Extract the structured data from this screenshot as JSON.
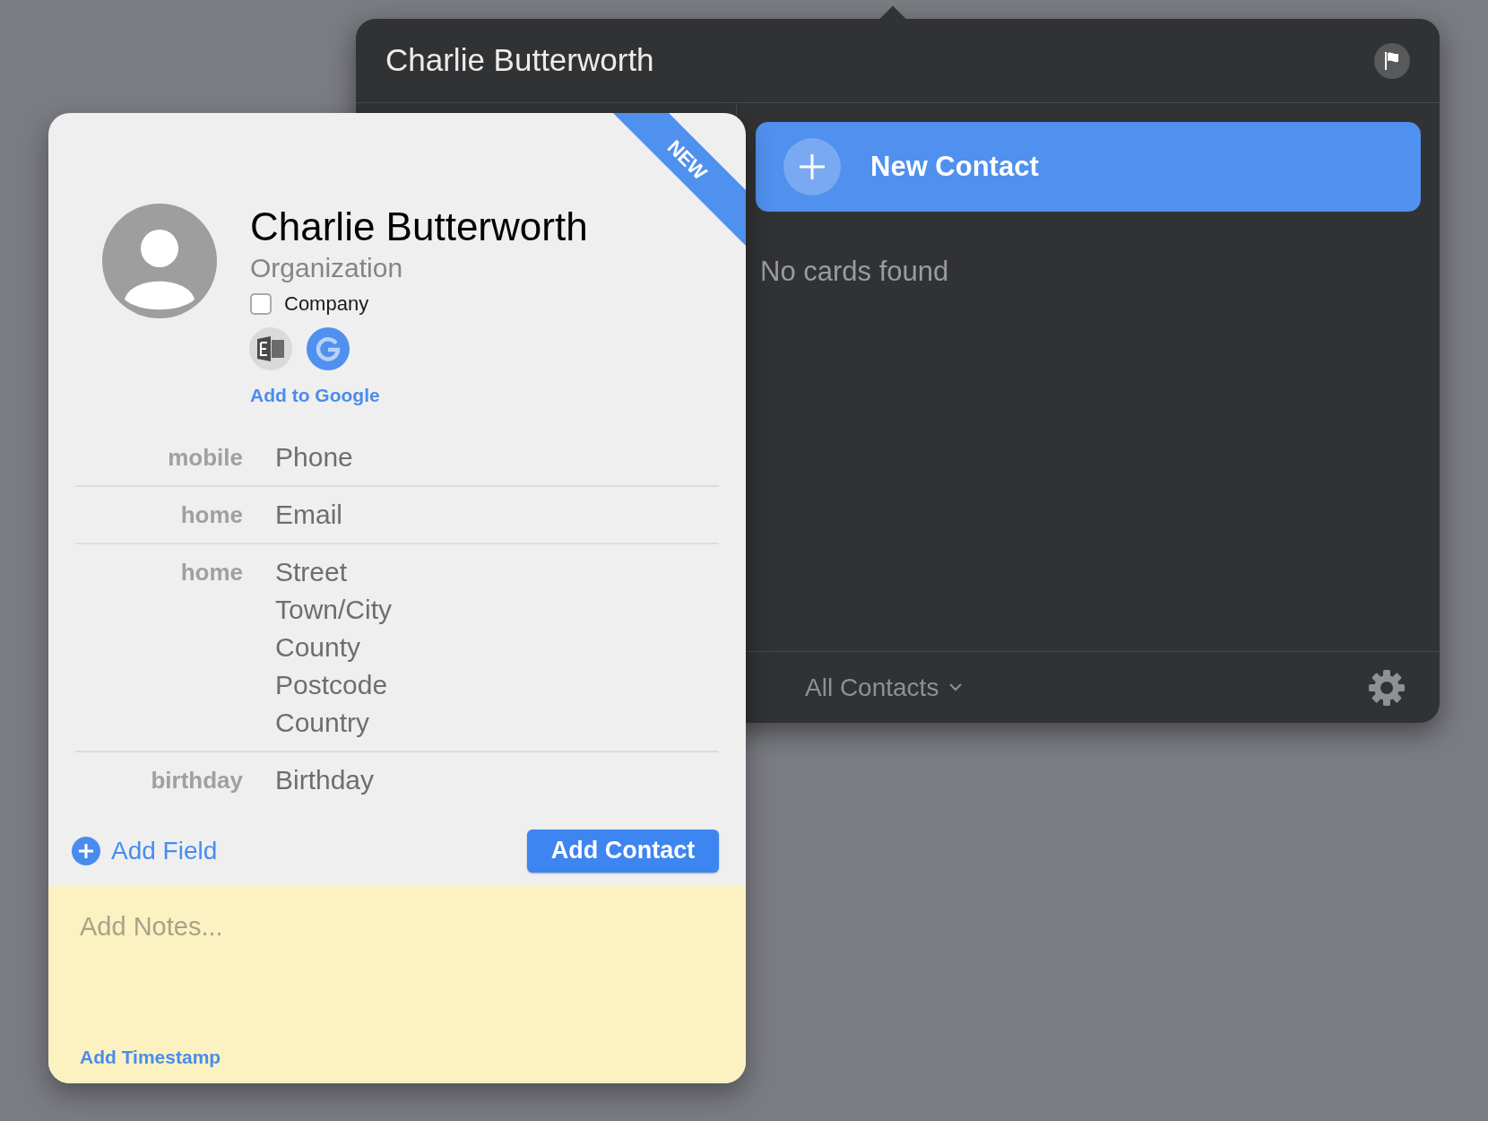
{
  "panel": {
    "title": "Charlie Butterworth",
    "new_contact_button": "New Contact",
    "empty_message": "No cards found",
    "footer": {
      "group_menu": "All Contacts"
    }
  },
  "card": {
    "ribbon": "NEW",
    "name": "Charlie Butterworth",
    "organization": {
      "placeholder": "Organization"
    },
    "company": {
      "label": "Company",
      "checked": false
    },
    "add_account_link": "Add to Google",
    "fields": [
      {
        "label": "mobile",
        "lines": [
          {
            "placeholder": "Phone"
          }
        ]
      },
      {
        "label": "home",
        "lines": [
          {
            "placeholder": "Email"
          }
        ]
      },
      {
        "label": "home",
        "lines": [
          {
            "placeholder": "Street"
          },
          {
            "placeholder": "Town/City"
          },
          {
            "placeholder": "County"
          },
          {
            "placeholder": "Postcode"
          },
          {
            "placeholder": "Country"
          }
        ]
      },
      {
        "label": "birthday",
        "lines": [
          {
            "placeholder": "Birthday"
          }
        ]
      }
    ],
    "add_field": "Add Field",
    "submit_button": "Add Contact",
    "notes": {
      "placeholder": "Add Notes...",
      "timestamp_link": "Add Timestamp"
    }
  }
}
